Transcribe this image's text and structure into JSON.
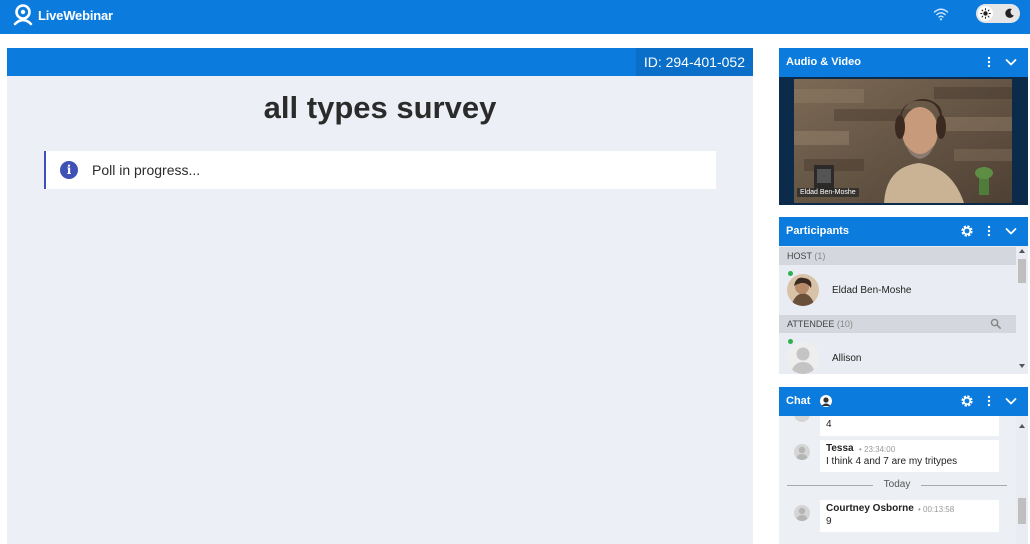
{
  "app": {
    "name": "LiveWebinar"
  },
  "stage": {
    "room_id": "ID: 294-401-052",
    "title": "all types survey",
    "poll_status": "Poll in progress..."
  },
  "audio_video": {
    "title": "Audio & Video",
    "speaker_label": "Eldad Ben-Moshe"
  },
  "participants": {
    "title": "Participants",
    "groups": [
      {
        "label": "HOST",
        "count": "(1)"
      },
      {
        "label": "ATTENDEE",
        "count": "(10)"
      }
    ],
    "people": [
      {
        "name": "Eldad Ben-Moshe",
        "group": "HOST"
      },
      {
        "name": "Allison",
        "group": "ATTENDEE"
      }
    ]
  },
  "chat": {
    "title": "Chat",
    "messages": [
      {
        "author": "",
        "time": "",
        "text": "4"
      },
      {
        "author": "Tessa",
        "time": "• 23:34:00",
        "text": "I think 4 and 7 are my tritypes"
      },
      {
        "author": "Courtney Osborne",
        "time": "• 00:13:58",
        "text": "9"
      }
    ],
    "day_separator": "Today"
  },
  "colors": {
    "brand_blue": "#0b7bde",
    "stage_bg": "#eceff6",
    "online_green": "#2bb24c",
    "info_indigo": "#3f51b5"
  },
  "icons": {
    "logo": "livewebinar-logo-icon",
    "wifi": "wifi-icon",
    "theme_light": "sun-icon",
    "theme_dark": "moon-icon",
    "info": "info-icon",
    "settings": "gear-icon",
    "more": "kebab-menu-icon",
    "collapse": "chevron-down-icon",
    "search": "search-icon"
  }
}
